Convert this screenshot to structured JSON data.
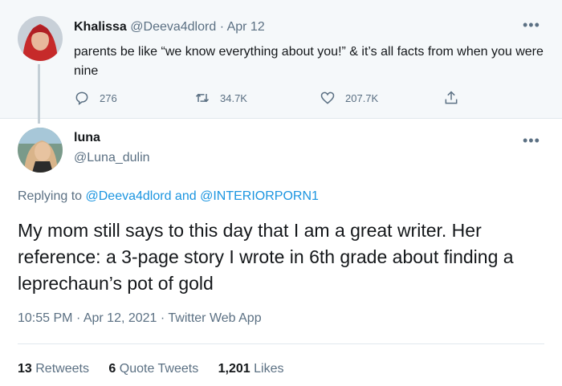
{
  "parent_tweet": {
    "name": "Khalissa",
    "handle": "@Deeva4dlord",
    "separator": "·",
    "date": "Apr 12",
    "more_icon": "more-dots-icon",
    "text": "parents be like “we know everything about you!” & it’s all facts from when you were nine",
    "actions": {
      "reply_count": "276",
      "retweet_count": "34.7K",
      "like_count": "207.7K"
    }
  },
  "main_tweet": {
    "name": "luna",
    "handle": "@Luna_dulin",
    "replying_prefix": "Replying to",
    "replying_user1": "@Deeva4dlord",
    "replying_and": "and",
    "replying_user2": "@INTERIORPORN1",
    "text": "My mom still says to this day that I am a great writer. Her reference: a 3-page story I wrote in 6th grade about finding a leprechaun’s pot of gold",
    "time": "10:55 PM",
    "date": "Apr 12, 2021",
    "source": "Twitter Web App",
    "separator": "·",
    "stats": {
      "retweets_count": "13",
      "retweets_label": "Retweets",
      "quotes_count": "6",
      "quotes_label": "Quote Tweets",
      "likes_count": "1,201",
      "likes_label": "Likes"
    }
  },
  "colors": {
    "link": "#1b95e0",
    "muted": "#5b7083",
    "parent_bg": "#f5f8fa"
  }
}
